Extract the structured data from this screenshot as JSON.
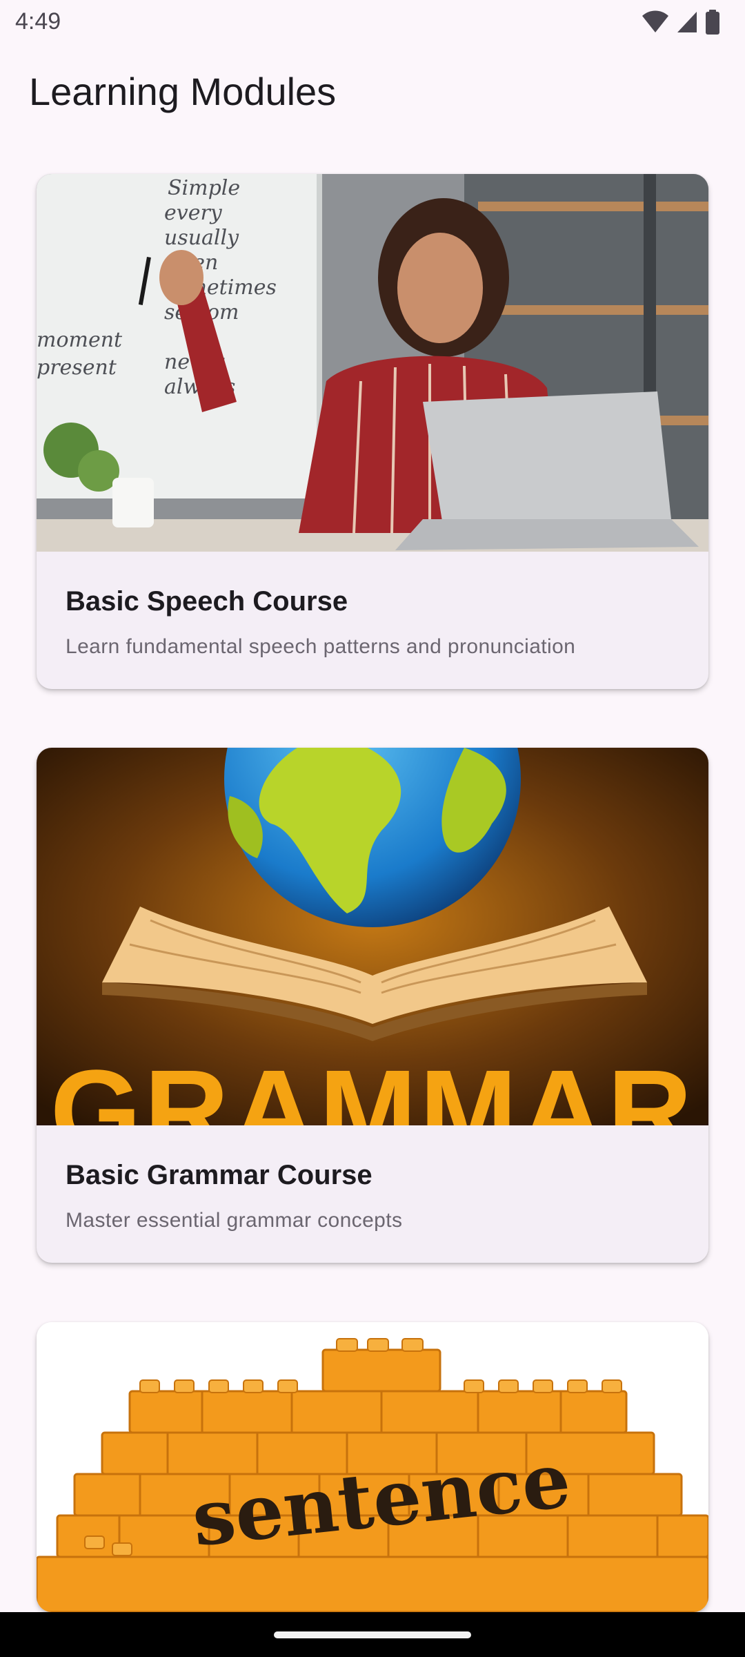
{
  "status_bar": {
    "time": "4:49",
    "icons": [
      "wifi-icon",
      "signal-icon",
      "battery-icon"
    ]
  },
  "header": {
    "title": "Learning Modules"
  },
  "modules": [
    {
      "title": "Basic Speech Course",
      "description": "Learn fundamental speech patterns and pronunciation",
      "board_words": [
        "Simple",
        "every",
        "usually",
        "often",
        "sometimes",
        "seldom",
        "never",
        "always",
        "moment",
        "present"
      ]
    },
    {
      "title": "Basic Grammar Course",
      "description": "Master essential grammar concepts",
      "image_text": "GRAMMAR"
    },
    {
      "image_text": "sentence"
    }
  ],
  "colors": {
    "background": "#fcf6fb",
    "card": "#f4eef6",
    "title_text": "#1d1b20",
    "secondary_text": "#6b6670",
    "grammar_accent": "#f5a312",
    "lego_orange": "#f39a1c"
  }
}
